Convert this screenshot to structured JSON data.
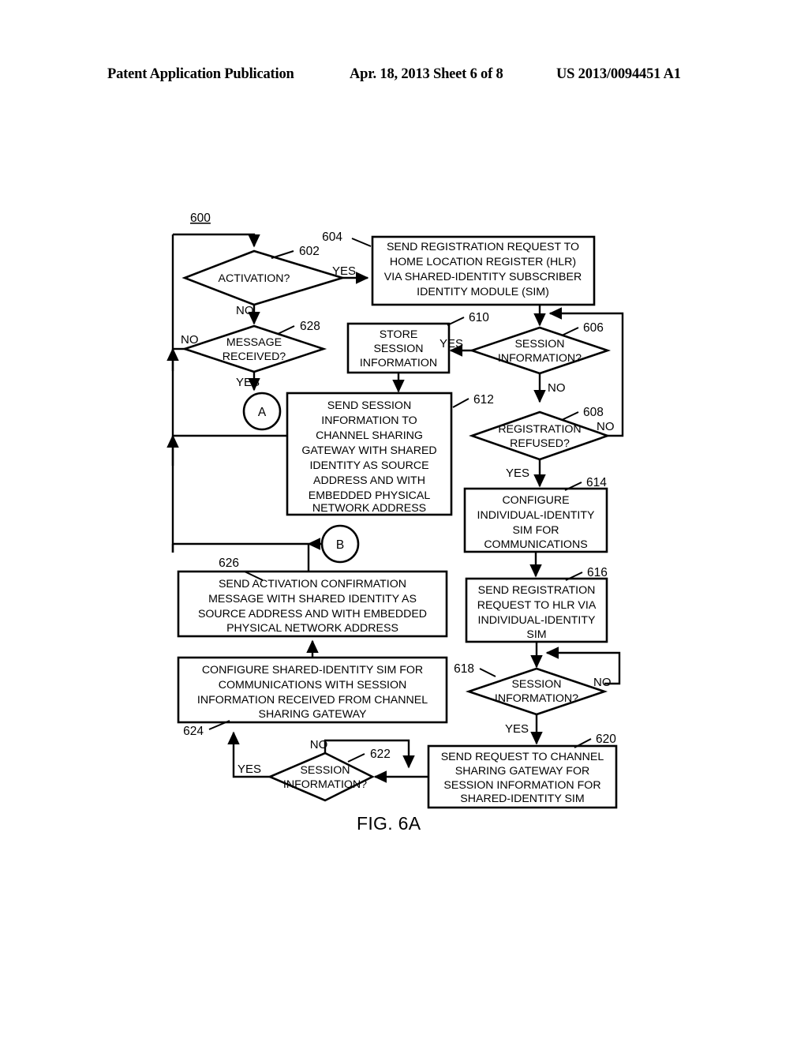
{
  "header": {
    "left": "Patent Application Publication",
    "middle": "Apr. 18, 2013  Sheet 6 of 8",
    "right": "US 2013/0094451 A1"
  },
  "figure": {
    "caption": "FIG. 6A",
    "diagram_ref": "600"
  },
  "labels": {
    "yes": "YES",
    "no": "NO",
    "connector_a": "A",
    "connector_b": "B"
  },
  "chart_data": {
    "type": "diagram",
    "diagram_kind": "flowchart",
    "title": "FIG. 6A",
    "ref": "600",
    "nodes": [
      {
        "id": "602",
        "ref": "602",
        "shape": "decision",
        "text": "ACTIVATION?"
      },
      {
        "id": "604",
        "ref": "604",
        "shape": "process",
        "text": "SEND REGISTRATION REQUEST TO HOME LOCATION REGISTER (HLR) VIA SHARED-IDENTITY SUBSCRIBER IDENTITY MODULE (SIM)"
      },
      {
        "id": "606",
        "ref": "606",
        "shape": "decision",
        "text": "SESSION INFORMATION?"
      },
      {
        "id": "608",
        "ref": "608",
        "shape": "decision",
        "text": "REGISTRATION REFUSED?"
      },
      {
        "id": "610",
        "ref": "610",
        "shape": "process",
        "text": "STORE SESSION INFORMATION"
      },
      {
        "id": "612",
        "ref": "612",
        "shape": "process",
        "text": "SEND SESSION INFORMATION TO CHANNEL SHARING GATEWAY WITH SHARED IDENTITY AS SOURCE ADDRESS AND WITH EMBEDDED PHYSICAL NETWORK ADDRESS"
      },
      {
        "id": "614",
        "ref": "614",
        "shape": "process",
        "text": "CONFIGURE INDIVIDUAL-IDENTITY SIM FOR COMMUNICATIONS"
      },
      {
        "id": "616",
        "ref": "616",
        "shape": "process",
        "text": "SEND REGISTRATION REQUEST TO HLR VIA INDIVIDUAL-IDENTITY SIM"
      },
      {
        "id": "618",
        "ref": "618",
        "shape": "decision",
        "text": "SESSION INFORMATION?"
      },
      {
        "id": "620",
        "ref": "620",
        "shape": "process",
        "text": "SEND REQUEST TO CHANNEL SHARING GATEWAY FOR SESSION INFORMATION FOR SHARED-IDENTITY SIM"
      },
      {
        "id": "622",
        "ref": "622",
        "shape": "decision",
        "text": "SESSION INFORMATION?"
      },
      {
        "id": "624",
        "ref": "624",
        "shape": "process",
        "text": "CONFIGURE SHARED-IDENTITY SIM FOR COMMUNICATIONS WITH SESSION INFORMATION RECEIVED FROM CHANNEL SHARING GATEWAY"
      },
      {
        "id": "626",
        "ref": "626",
        "shape": "process",
        "text": "SEND ACTIVATION CONFIRMATION MESSAGE WITH SHARED IDENTITY AS SOURCE ADDRESS AND WITH EMBEDDED PHYSICAL NETWORK ADDRESS"
      },
      {
        "id": "628",
        "ref": "628",
        "shape": "decision",
        "text": "MESSAGE RECEIVED?"
      },
      {
        "id": "A",
        "ref": "A",
        "shape": "connector",
        "text": "A"
      },
      {
        "id": "B",
        "ref": "B",
        "shape": "connector",
        "text": "B"
      }
    ],
    "edges": [
      {
        "from": "602",
        "to": "604",
        "label": "YES"
      },
      {
        "from": "602",
        "to": "628",
        "label": "NO"
      },
      {
        "from": "628",
        "to": "602",
        "label": "NO"
      },
      {
        "from": "628",
        "to": "A",
        "label": "YES"
      },
      {
        "from": "604",
        "to": "606",
        "label": ""
      },
      {
        "from": "606",
        "to": "610",
        "label": "YES"
      },
      {
        "from": "606",
        "to": "608",
        "label": "NO"
      },
      {
        "from": "608",
        "to": "606",
        "label": "NO"
      },
      {
        "from": "608",
        "to": "614",
        "label": "YES"
      },
      {
        "from": "610",
        "to": "612",
        "label": ""
      },
      {
        "from": "612",
        "to": "602",
        "label": ""
      },
      {
        "from": "614",
        "to": "616",
        "label": ""
      },
      {
        "from": "616",
        "to": "618",
        "label": ""
      },
      {
        "from": "618",
        "to": "620",
        "label": "YES"
      },
      {
        "from": "618",
        "to": "618",
        "label": "NO"
      },
      {
        "from": "620",
        "to": "622",
        "label": ""
      },
      {
        "from": "622",
        "to": "624",
        "label": "YES"
      },
      {
        "from": "622",
        "to": "622",
        "label": "NO"
      },
      {
        "from": "624",
        "to": "626",
        "label": ""
      },
      {
        "from": "B",
        "to": "626",
        "label": ""
      },
      {
        "from": "626",
        "to": "602",
        "label": ""
      }
    ]
  },
  "nodes": {
    "n602": {
      "ref": "602",
      "lines": [
        "ACTIVATION?"
      ]
    },
    "n604": {
      "ref": "604",
      "lines": [
        "SEND REGISTRATION REQUEST TO",
        "HOME LOCATION REGISTER (HLR)",
        "VIA SHARED-IDENTITY SUBSCRIBER",
        "IDENTITY MODULE (SIM)"
      ]
    },
    "n606": {
      "ref": "606",
      "lines": [
        "SESSION",
        "INFORMATION?"
      ]
    },
    "n608": {
      "ref": "608",
      "lines": [
        "REGISTRATION",
        "REFUSED?"
      ]
    },
    "n610": {
      "ref": "610",
      "lines": [
        "STORE",
        "SESSION",
        "INFORMATION"
      ]
    },
    "n612": {
      "ref": "612",
      "lines": [
        "SEND SESSION",
        "INFORMATION TO",
        "CHANNEL SHARING",
        "GATEWAY WITH SHARED",
        "IDENTITY AS SOURCE",
        "ADDRESS AND WITH",
        "EMBEDDED PHYSICAL",
        "NETWORK ADDRESS"
      ]
    },
    "n614": {
      "ref": "614",
      "lines": [
        "CONFIGURE",
        "INDIVIDUAL-IDENTITY",
        "SIM FOR",
        "COMMUNICATIONS"
      ]
    },
    "n616": {
      "ref": "616",
      "lines": [
        "SEND REGISTRATION",
        "REQUEST TO HLR VIA",
        "INDIVIDUAL-IDENTITY",
        "SIM"
      ]
    },
    "n618": {
      "ref": "618",
      "lines": [
        "SESSION",
        "INFORMATION?"
      ]
    },
    "n620": {
      "ref": "620",
      "lines": [
        "SEND REQUEST TO CHANNEL",
        "SHARING GATEWAY FOR",
        "SESSION INFORMATION FOR",
        "SHARED-IDENTITY SIM"
      ]
    },
    "n622": {
      "ref": "622",
      "lines": [
        "SESSION",
        "INFORMATION?"
      ]
    },
    "n624": {
      "ref": "624",
      "lines": [
        "CONFIGURE SHARED-IDENTITY SIM FOR",
        "COMMUNICATIONS WITH SESSION",
        "INFORMATION RECEIVED FROM CHANNEL",
        "SHARING GATEWAY"
      ]
    },
    "n626": {
      "ref": "626",
      "lines": [
        "SEND ACTIVATION CONFIRMATION",
        "MESSAGE WITH SHARED IDENTITY AS",
        "SOURCE ADDRESS AND WITH EMBEDDED",
        "PHYSICAL NETWORK ADDRESS"
      ]
    },
    "n628": {
      "ref": "628",
      "lines": [
        "MESSAGE",
        "RECEIVED?"
      ]
    }
  }
}
